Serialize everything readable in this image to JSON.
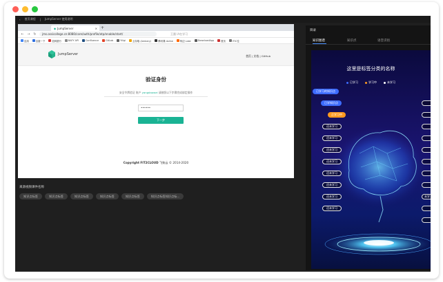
{
  "window": {
    "top_nav": [
      "首页课程",
      "JumpServer 使用说明"
    ]
  },
  "browser": {
    "tab_title": "JumpServer",
    "url": "jms.ossicollege.cn:8080/core/auth/profile/otp/enable/start/",
    "watermark": "王晨 IA在学习",
    "bookmarks": [
      "应用",
      "百度一下",
      "招商银行",
      "BAFY API",
      "Confluence",
      "GitLab",
      "Ylligi",
      "云存取 (Ambery)",
      "腾讯课 doline",
      "阿边 Lake",
      "DownloadApp",
      "首页",
      "ITIC位"
    ]
  },
  "jumpserver": {
    "logo_text": "JumpServer",
    "header_links": "首页 | 文档 | GitHub",
    "verify_title": "验证身份",
    "hint_prefix": "安全令牌验证 账户",
    "hint_user": "yangdaowei",
    "hint_suffix": "请按照以下步骤完成绑定操作",
    "code_value": "••••••",
    "next_button": "下一步",
    "copyright_company": "Copyright FIT2CLOUD",
    "copyright_rest": "飞致云 © 2014-2020"
  },
  "source": {
    "title": "来源视频课件名称",
    "chips": [
      "知识点标签",
      "知识点标签",
      "知识点标签",
      "知识点标签",
      "知识点标签",
      "知识点标签知识点标..."
    ]
  },
  "right_panel": {
    "title": "目录",
    "tabs": [
      "知识图谱",
      "知识点",
      "语音识别"
    ],
    "active_tab": 0,
    "stage_title": "这里是标签分类的名称",
    "legend": [
      {
        "label": "已学习",
        "color": "#3d6cff"
      },
      {
        "label": "学习中",
        "color": "#ff9a1f"
      },
      {
        "label": "未学习",
        "color": "#ffffff"
      }
    ],
    "nodes": [
      {
        "label": "已学习的知识点",
        "state": "done"
      },
      {
        "label": "已学知识点",
        "state": "done"
      },
      {
        "label": "正学习中",
        "state": "doing"
      },
      {
        "label": "还未学习",
        "state": "todo"
      },
      {
        "label": "还未学习",
        "state": "todo"
      },
      {
        "label": "还未学习",
        "state": "todo"
      },
      {
        "label": "还未学习",
        "state": "todo"
      },
      {
        "label": "还未学习",
        "state": "todo"
      },
      {
        "label": "还未学习",
        "state": "todo"
      },
      {
        "label": "还未学习",
        "state": "todo"
      },
      {
        "label": "还未学习",
        "state": "todo"
      }
    ],
    "edge_chips": [
      "",
      "",
      "",
      "",
      "",
      "",
      "",
      "",
      "未学",
      "",
      ""
    ]
  },
  "colors": {
    "accent_green": "#1ab394",
    "learned": "#3d6cff",
    "learning": "#ff9a1f"
  }
}
